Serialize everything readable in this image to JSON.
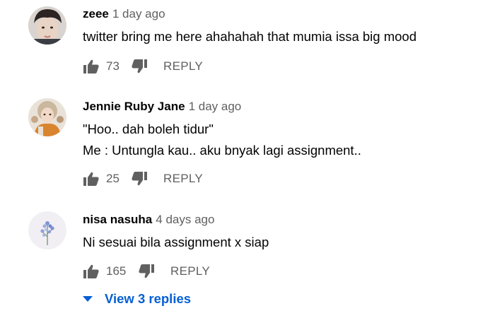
{
  "comments": [
    {
      "author": "zeee",
      "time": "1 day ago",
      "lines": [
        "twitter bring me here ahahahah that mumia issa big mood"
      ],
      "likes": "73",
      "reply_label": "REPLY"
    },
    {
      "author": "Jennie Ruby Jane",
      "time": "1 day ago",
      "lines": [
        "\"Hoo.. dah boleh tidur\"",
        "Me : Untungla kau.. aku bnyak lagi assignment.."
      ],
      "likes": "25",
      "reply_label": "REPLY"
    },
    {
      "author": "nisa nasuha",
      "time": "4 days ago",
      "lines": [
        "Ni sesuai bila assignment x siap"
      ],
      "likes": "165",
      "reply_label": "REPLY"
    }
  ],
  "view_replies": "View 3 replies",
  "colors": {
    "link": "#065fd4",
    "secondary_text": "#606060",
    "icon": "#606060"
  },
  "icons": {
    "like": "thumbs-up-icon",
    "dislike": "thumbs-down-icon",
    "expand": "caret-down-icon"
  }
}
